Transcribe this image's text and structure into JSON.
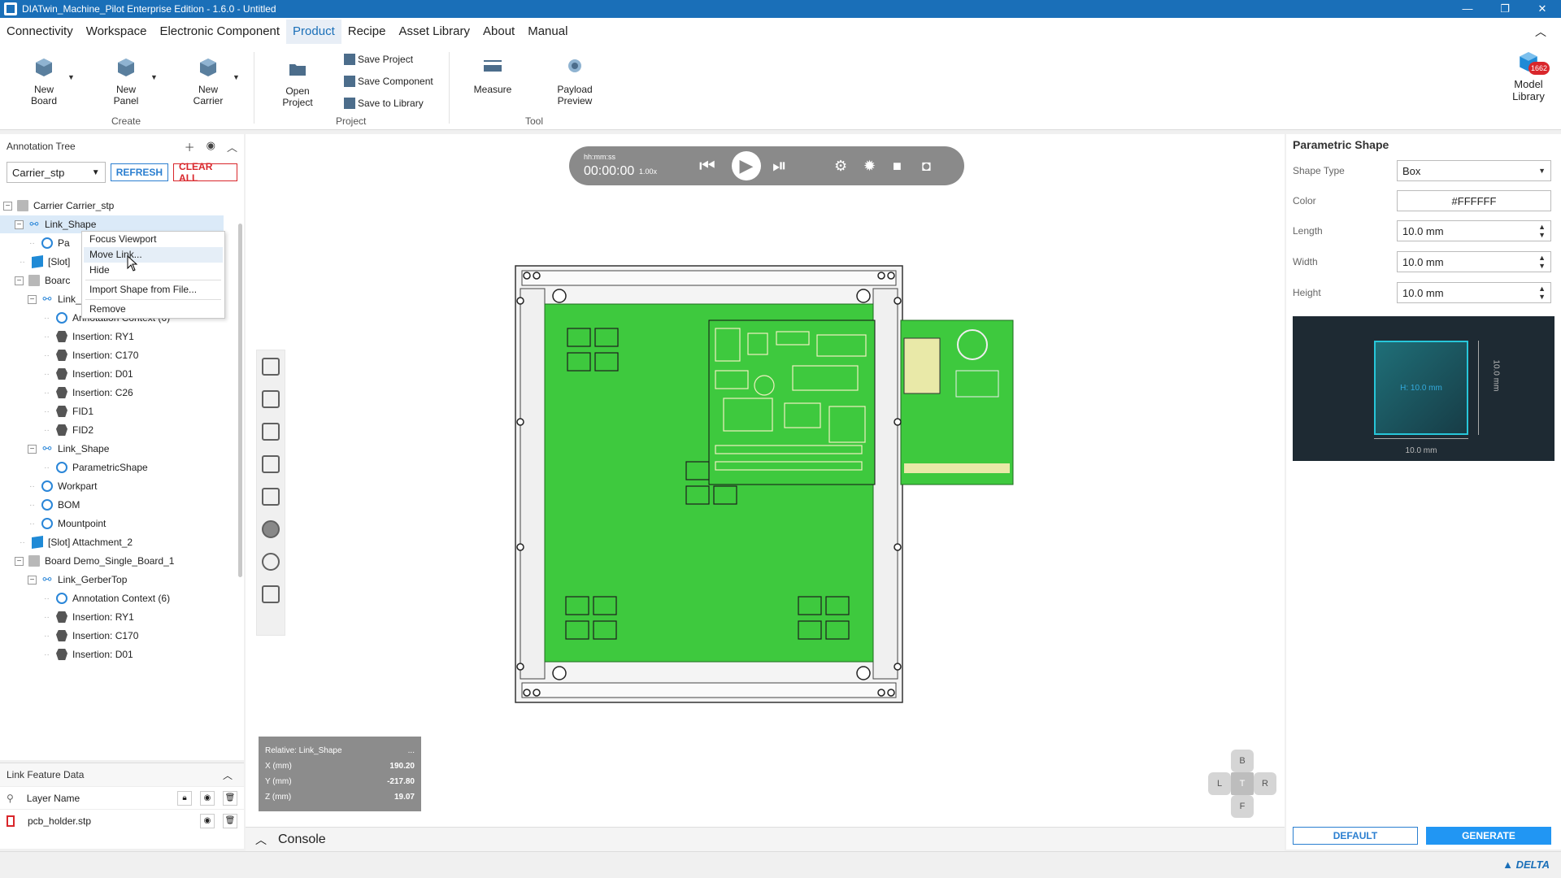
{
  "window": {
    "title": "DIATwin_Machine_Pilot Enterprise Edition - 1.6.0 - Untitled",
    "controls": [
      "—",
      "❐",
      "✕"
    ]
  },
  "menu": [
    "Connectivity",
    "Workspace",
    "Electronic Component",
    "Product",
    "Recipe",
    "Asset Library",
    "About",
    "Manual"
  ],
  "ribbon": {
    "new_board": "New Board",
    "new_panel": "New Panel",
    "new_carrier": "New Carrier",
    "create_group": "Create",
    "open_project": "Open Project",
    "save_project": "Save Project",
    "save_component": "Save Component",
    "save_to_library": "Save to Library",
    "project_group": "Project",
    "measure": "Measure",
    "payload_preview": "Payload Preview",
    "tool_group": "Tool",
    "model_library": "Model Library",
    "model_library_badge": "1662"
  },
  "annotation_tree": {
    "title": "Annotation Tree",
    "selected_carrier": "Carrier_stp",
    "refresh": "REFRESH",
    "clear_all": "CLEAR ALL",
    "rows": [
      {
        "text": "Carrier  Carrier_stp"
      },
      {
        "text": "Link_Shape"
      },
      {
        "text": "Pa"
      },
      {
        "text": "[Slot]"
      },
      {
        "text": "Boarc"
      },
      {
        "text": "Link_GerberTop"
      },
      {
        "text": "Annotation Context (6)"
      },
      {
        "text": "Insertion: RY1"
      },
      {
        "text": "Insertion: C170"
      },
      {
        "text": "Insertion: D01"
      },
      {
        "text": "Insertion: C26"
      },
      {
        "text": "FID1"
      },
      {
        "text": "FID2"
      },
      {
        "text": "Link_Shape"
      },
      {
        "text": "ParametricShape"
      },
      {
        "text": "Workpart"
      },
      {
        "text": "BOM"
      },
      {
        "text": "Mountpoint"
      },
      {
        "text": "[Slot] Attachment_2"
      },
      {
        "text": "Board  Demo_Single_Board_1"
      },
      {
        "text": "Link_GerberTop"
      },
      {
        "text": "Annotation Context (6)"
      },
      {
        "text": "Insertion: RY1"
      },
      {
        "text": "Insertion: C170"
      },
      {
        "text": "Insertion: D01"
      }
    ]
  },
  "context_menu": [
    "Focus Viewport",
    "Move Link...",
    "Hide",
    "Import Shape from File...",
    "Remove"
  ],
  "link_feature_data": {
    "title": "Link Feature Data",
    "column": "Layer Name",
    "row_name": "pcb_holder.stp"
  },
  "player": {
    "time_label": "hh:mm:ss",
    "time": "00:00:00",
    "speed": "1.00x"
  },
  "coords": {
    "title": "Relative: Link_Shape",
    "more": "...",
    "x_label": "X (mm)",
    "x": "190.20",
    "y_label": "Y (mm)",
    "y": "-217.80",
    "z_label": "Z (mm)",
    "z": "19.07"
  },
  "navcube": {
    "top": "B",
    "left": "L",
    "center": "T",
    "right": "R",
    "bottom": "F"
  },
  "console": {
    "label": "Console"
  },
  "parametric_shape": {
    "title": "Parametric Shape",
    "shape_type_label": "Shape Type",
    "shape_type": "Box",
    "color_label": "Color",
    "color": "#FFFFFF",
    "length_label": "Length",
    "length": "10.0 mm",
    "width_label": "Width",
    "width": "10.0 mm",
    "height_label": "Height",
    "height": "10.0 mm",
    "preview_height": "H: 10.0 mm",
    "preview_dim_bottom": "10.0 mm",
    "preview_dim_right": "10.0 mm",
    "default": "DEFAULT",
    "generate": "GENERATE"
  },
  "brand": "▲ DELTA",
  "colors": {
    "accent": "#1a6fb8",
    "pcb_green": "#3ec93e",
    "danger": "#d9262b"
  }
}
